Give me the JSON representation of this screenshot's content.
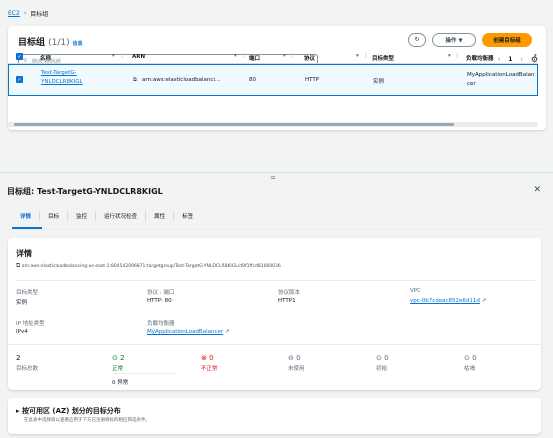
{
  "breadcrumb": {
    "root": "EC2",
    "sep": "›",
    "current": "目标组"
  },
  "panel": {
    "title": "目标组",
    "count": "(1/1)",
    "info": "信息",
    "refresh_icon": "↻",
    "actions": "操作 ▼",
    "create": "创建目标组",
    "search_placeholder": "筛选 目标组",
    "page": "1",
    "prev": "‹",
    "next": "›",
    "gear": "⚙"
  },
  "table": {
    "headers": [
      "名称",
      "ARN",
      "端口",
      "协议",
      "目标类型",
      "负载均衡器"
    ],
    "row": {
      "name": "Test-TargetG-YNLDCLR8KIGL",
      "arn": "arn:aws:elasticloadbalanci...",
      "port": "80",
      "protocol": "HTTP",
      "target_type": "实例",
      "lb": "MyApplicationLoadBalancer"
    }
  },
  "detail": {
    "title": "目标组: Test-TargetG-YNLDCLR8KIGL",
    "tabs": [
      "详情",
      "目标",
      "监控",
      "运行状况检查",
      "属性",
      "标签"
    ],
    "section": "详情",
    "arn": "arn:aws:elasticloadbalancing:us-east-1:804542096871:targetgroup/Test-TargetG-YNLDCLR8KIGL/d9f1ffcd81060036",
    "fields": {
      "type_label": "目标类型",
      "type_value": "实例",
      "proto_label": "协议 : 端口",
      "proto_value": "HTTP: 80",
      "version_label": "协议版本",
      "version_value": "HTTP1",
      "vpc_label": "VPC",
      "vpc_value": "vpc-0b7cdeac852e6d11d",
      "ip_label": "IP 地址类型",
      "ip_value": "IPv4",
      "lb_label": "负载均衡器",
      "lb_value": "MyApplicationLoadBalancer"
    },
    "stats": {
      "total": "2",
      "total_label": "目标总数",
      "healthy": "2",
      "healthy_label": "正常",
      "unhealthy": "0",
      "unhealthy_label": "不正常",
      "unused": "0",
      "unused_label": "未使用",
      "initial": "0",
      "initial_label": "初始",
      "draining": "0",
      "draining_label": "枯竭",
      "anomalous": "0 异常"
    },
    "az_title": "按可用区 (AZ) 划分的目标分布",
    "az_desc": "在此表中选择值以查看应用于下方已注册目标的相应筛选条件。"
  }
}
